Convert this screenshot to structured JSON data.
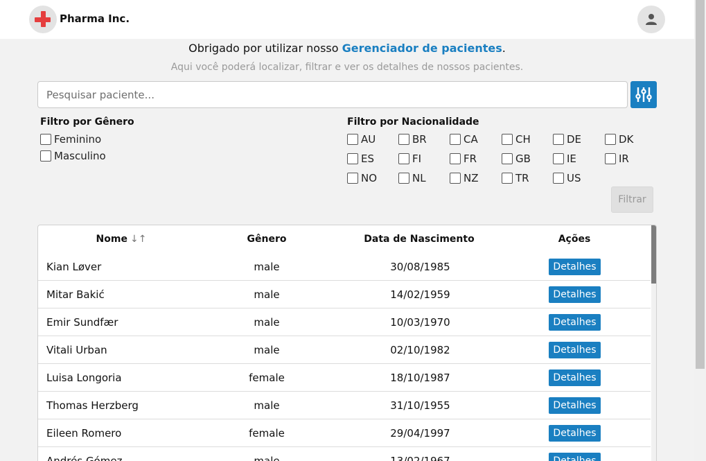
{
  "header": {
    "brand": "Pharma Inc.",
    "logo_icon": "red-cross-icon",
    "user_icon": "user-icon"
  },
  "intro": {
    "text_before": "Obrigado por utilizar nosso ",
    "highlight": "Gerenciador de pacientes",
    "text_after": ".",
    "subtitle": "Aqui você poderá localizar, filtrar e ver os detalhes de nossos pacientes."
  },
  "search": {
    "placeholder": "Pesquisar paciente...",
    "value": "",
    "filter_toggle_icon": "sliders-icon"
  },
  "gender_filter": {
    "title": "Filtro por Gênero",
    "options": [
      "Feminino",
      "Masculino"
    ]
  },
  "nationality_filter": {
    "title": "Filtro por Nacionalidade",
    "options": [
      "AU",
      "BR",
      "CA",
      "CH",
      "DE",
      "DK",
      "ES",
      "FI",
      "FR",
      "GB",
      "IE",
      "IR",
      "NO",
      "NL",
      "NZ",
      "TR",
      "US"
    ]
  },
  "filter_button": "Filtrar",
  "table": {
    "headers": {
      "name": "Nome",
      "name_sort_icon": "↓↑",
      "gender": "Gênero",
      "birth": "Data de Nascimento",
      "actions": "Ações"
    },
    "action_label": "Detalhes",
    "rows": [
      {
        "name": "Kian Løver",
        "gender": "male",
        "birth": "30/08/1985"
      },
      {
        "name": "Mitar Bakić",
        "gender": "male",
        "birth": "14/02/1959"
      },
      {
        "name": "Emir Sundfær",
        "gender": "male",
        "birth": "10/03/1970"
      },
      {
        "name": "Vitali Urban",
        "gender": "male",
        "birth": "02/10/1982"
      },
      {
        "name": "Luisa Longoria",
        "gender": "female",
        "birth": "18/10/1987"
      },
      {
        "name": "Thomas Herzberg",
        "gender": "male",
        "birth": "31/10/1955"
      },
      {
        "name": "Eileen Romero",
        "gender": "female",
        "birth": "29/04/1997"
      },
      {
        "name": "Andrés Gómez",
        "gender": "male",
        "birth": "13/02/1967"
      }
    ]
  },
  "colors": {
    "accent": "#1a7fc1",
    "logo_red": "#e53e3e",
    "background": "#f2f2f2"
  }
}
